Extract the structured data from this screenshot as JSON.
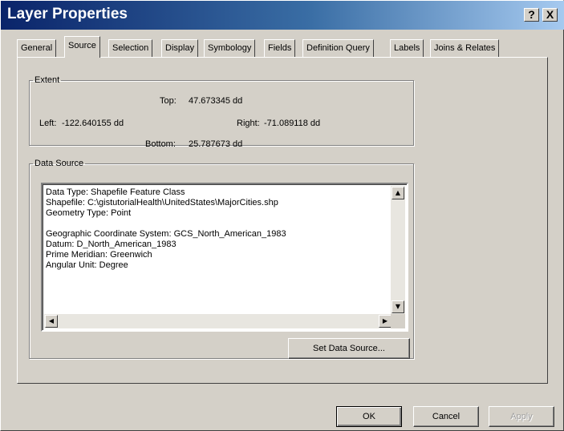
{
  "window": {
    "title": "Layer Properties",
    "help_btn": "?",
    "close_btn": "X"
  },
  "tabs": [
    "General",
    "Source",
    "Selection",
    "Display",
    "Symbology",
    "Fields",
    "Definition Query",
    "Labels",
    "Joins & Relates"
  ],
  "active_tab": "Source",
  "extent": {
    "legend": "Extent",
    "top_label": "Top:",
    "top_value": "47.673345 dd",
    "left_label": "Left:",
    "left_value": "-122.640155 dd",
    "right_label": "Right:",
    "right_value": "-71.089118 dd",
    "bottom_label": "Bottom:",
    "bottom_value": "25.787673 dd"
  },
  "data_source": {
    "legend": "Data Source",
    "lines": [
      "Data Type: Shapefile Feature Class",
      "Shapefile: C:\\gistutorialHealth\\UnitedStates\\MajorCities.shp",
      "Geometry Type: Point",
      "",
      "Geographic Coordinate System: GCS_North_American_1983",
      "Datum: D_North_American_1983",
      "Prime Meridian: Greenwich",
      "Angular Unit: Degree"
    ],
    "set_button": "Set Data Source..."
  },
  "footer": {
    "ok": "OK",
    "cancel": "Cancel",
    "apply": "Apply"
  }
}
